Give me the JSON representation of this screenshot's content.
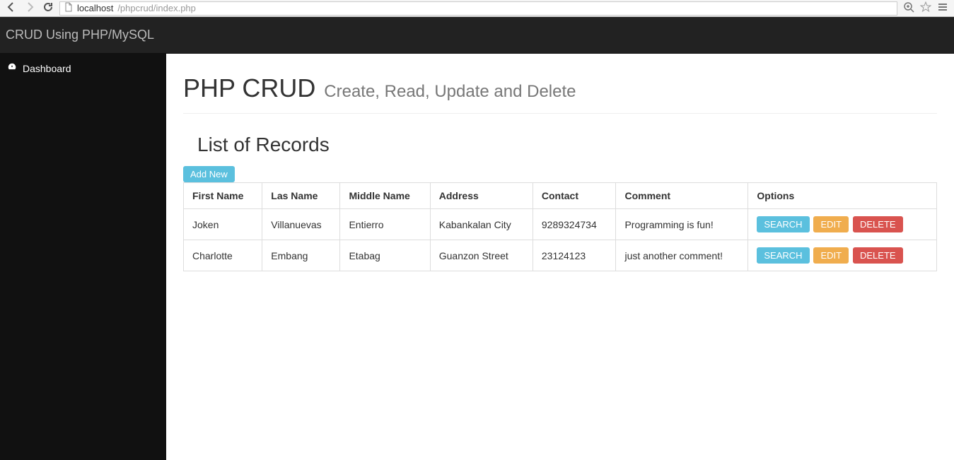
{
  "browser": {
    "url_host": "localhost",
    "url_path": "/phpcrud/index.php"
  },
  "topbar": {
    "brand": "CRUD Using PHP/MySQL"
  },
  "sidebar": {
    "items": [
      {
        "label": "Dashboard"
      }
    ]
  },
  "page": {
    "title": "PHP CRUD",
    "subtitle": "Create, Read, Update and Delete",
    "section_title": "List of Records",
    "add_new_label": "Add New"
  },
  "table": {
    "headers": [
      "First Name",
      "Las Name",
      "Middle Name",
      "Address",
      "Contact",
      "Comment",
      "Options"
    ],
    "rows": [
      {
        "first": "Joken",
        "last": "Villanuevas",
        "middle": "Entierro",
        "address": "Kabankalan City",
        "contact": "9289324734",
        "comment": "Programming is fun!"
      },
      {
        "first": "Charlotte",
        "last": "Embang",
        "middle": "Etabag",
        "address": "Guanzon Street",
        "contact": "23124123",
        "comment": "just another comment!"
      }
    ],
    "buttons": {
      "search": "SEARCH",
      "edit": "EDIT",
      "delete": "DELETE"
    }
  }
}
